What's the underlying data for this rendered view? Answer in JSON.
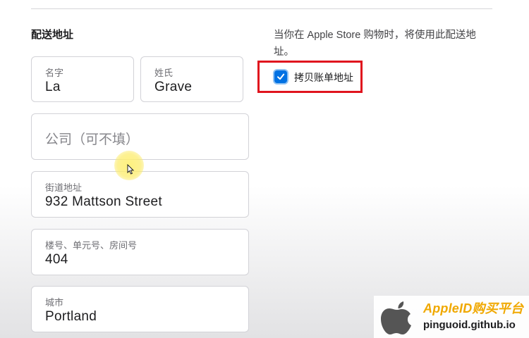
{
  "section": {
    "title": "配送地址"
  },
  "fields": {
    "first_name": {
      "label": "名字",
      "value": "La"
    },
    "last_name": {
      "label": "姓氏",
      "value": "Grave"
    },
    "company": {
      "placeholder": "公司（可不填）"
    },
    "street": {
      "label": "街道地址",
      "value": "932  Mattson Street"
    },
    "unit": {
      "label": "楼号、单元号、房间号",
      "value": "404"
    },
    "city": {
      "label": "城市",
      "value": "Portland"
    }
  },
  "hint": {
    "text": "当你在 Apple Store 购物时，将使用此配送地址。"
  },
  "copy_billing": {
    "label": "拷贝账单地址",
    "checked": true
  },
  "icons": [
    "check-icon",
    "mouse-cursor-icon",
    "apple-logo-icon"
  ],
  "colors": {
    "accent": "#0071e3",
    "highlight": "#e0141e",
    "watermark": "#f0a800"
  },
  "watermark": {
    "title": "AppleID购买平台",
    "url": "pinguoid.github.io"
  }
}
